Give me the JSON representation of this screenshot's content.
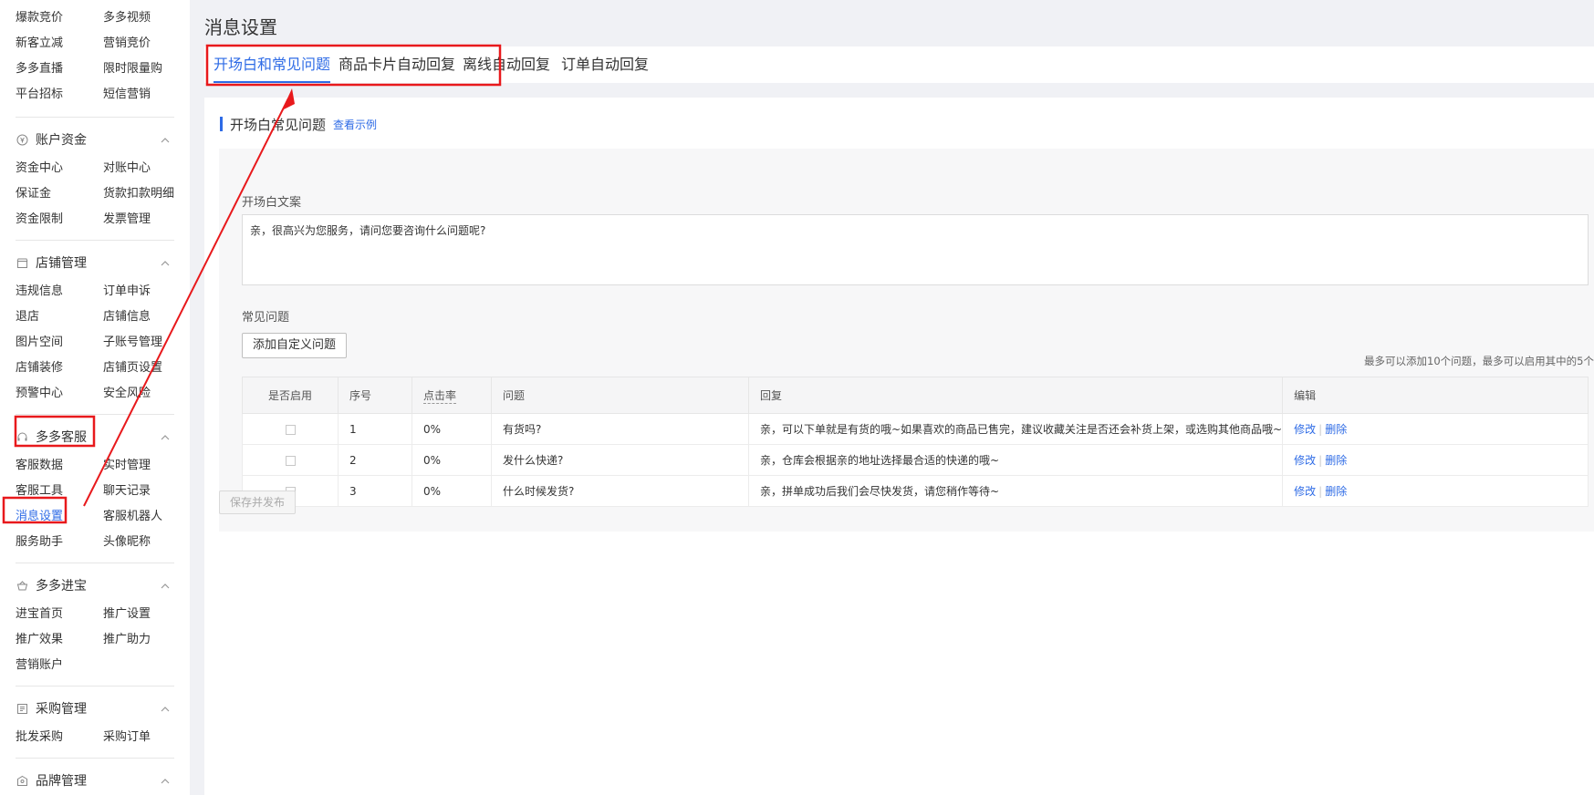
{
  "sidebar": {
    "top_items": [
      "爆款竞价",
      "多多视频",
      "新客立减",
      "营销竞价",
      "多多直播",
      "限时限量购",
      "平台招标",
      "短信营销"
    ],
    "sections": [
      {
        "title": "账户资金",
        "icon": "money-icon",
        "items": [
          "资金中心",
          "对账中心",
          "保证金",
          "货款扣款明细",
          "资金限制",
          "发票管理"
        ]
      },
      {
        "title": "店铺管理",
        "icon": "store-icon",
        "items": [
          "违规信息",
          "订单申诉",
          "退店",
          "店铺信息",
          "图片空间",
          "子账号管理",
          "店铺装修",
          "店铺页设置",
          "预警中心",
          "安全风险"
        ]
      },
      {
        "title": "多多客服",
        "icon": "headset-icon",
        "items": [
          "客服数据",
          "实时管理",
          "客服工具",
          "聊天记录",
          "消息设置",
          "客服机器人",
          "服务助手",
          "头像昵称"
        ]
      },
      {
        "title": "多多进宝",
        "icon": "treasure-icon",
        "items": [
          "进宝首页",
          "推广设置",
          "推广效果",
          "推广助力",
          "营销账户"
        ]
      },
      {
        "title": "采购管理",
        "icon": "purchase-icon",
        "items": [
          "批发采购",
          "采购订单"
        ]
      },
      {
        "title": "品牌管理",
        "icon": "brand-icon",
        "items": []
      }
    ],
    "active_item": "消息设置"
  },
  "page": {
    "title": "消息设置",
    "tabs": [
      "开场白和常见问题",
      "商品卡片自动回复",
      "离线自动回复",
      "订单自动回复"
    ],
    "active_tab": 0
  },
  "section": {
    "title": "开场白常见问题",
    "example_link": "查看示例"
  },
  "opening": {
    "label": "开场白文案",
    "text": "亲，很高兴为您服务，请问您要咨询什么问题呢?"
  },
  "faq": {
    "label": "常见问题",
    "add_button": "添加自定义问题",
    "limit_note": "最多可以添加10个问题，最多可以启用其中的5个",
    "columns": [
      "是否启用",
      "序号",
      "点击率",
      "问题",
      "回复",
      "编辑"
    ],
    "rows": [
      {
        "index": "1",
        "rate": "0%",
        "question": "有货吗?",
        "reply": "亲，可以下单就是有货的哦~如果喜欢的商品已售完，建议收藏关注是否还会补货上架，或选购其他商品哦~"
      },
      {
        "index": "2",
        "rate": "0%",
        "question": "发什么快递?",
        "reply": "亲，仓库会根据亲的地址选择最合适的快递的哦~"
      },
      {
        "index": "3",
        "rate": "0%",
        "question": "什么时候发货?",
        "reply": "亲，拼单成功后我们会尽快发货，请您稍作等待~"
      }
    ],
    "edit_label": "修改",
    "delete_label": "删除"
  },
  "save_button": "保存并发布",
  "colors": {
    "accent": "#2e6be6",
    "annotation": "#e8191c"
  }
}
